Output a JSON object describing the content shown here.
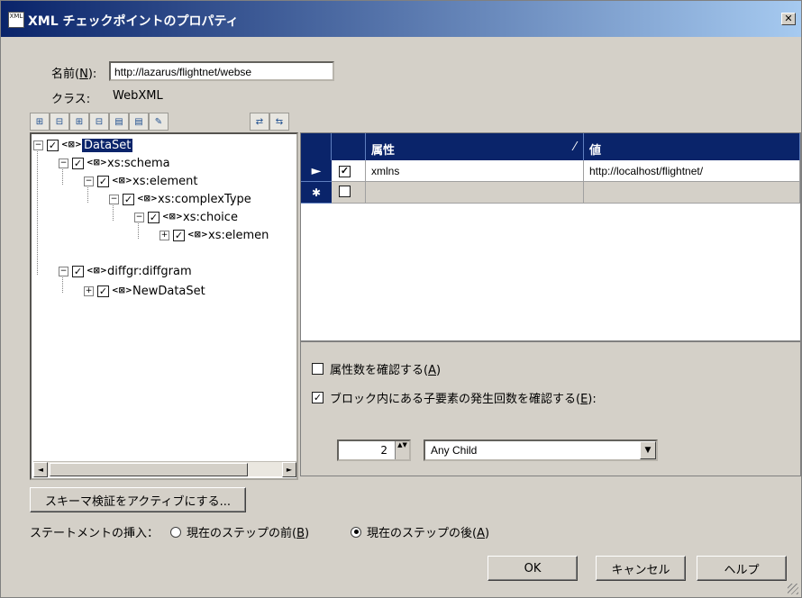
{
  "window": {
    "icon_label": "XML",
    "title": "XML チェックポイントのプロパティ",
    "close_glyph": "✕"
  },
  "name_field": {
    "label_prefix": "名前(",
    "label_hotkey": "N",
    "label_suffix": "):",
    "value": "http://lazarus/flightnet/webse"
  },
  "class_field": {
    "label": "クラス:",
    "value": "WebXML"
  },
  "toolbar": {
    "buttons": [
      {
        "icon": "add-child-icon"
      },
      {
        "icon": "add-sibling-icon"
      },
      {
        "icon": "add-attribute-icon"
      },
      {
        "icon": "remove-icon"
      },
      {
        "icon": "xml-import-icon"
      },
      {
        "icon": "xml-export-icon"
      },
      {
        "icon": "edit-icon"
      },
      {
        "icon": "check-all-icon"
      },
      {
        "icon": "uncheck-all-icon"
      }
    ]
  },
  "tree": {
    "nodes": [
      {
        "label": "DataSet",
        "expander": "−",
        "checked": "✓",
        "selected": true
      },
      {
        "label": "xs:schema",
        "expander": "−",
        "checked": "✓"
      },
      {
        "label": "xs:element",
        "expander": "−",
        "checked": "✓"
      },
      {
        "label": "xs:complexType",
        "expander": "−",
        "checked": "✓"
      },
      {
        "label": "xs:choice",
        "expander": "−",
        "checked": "✓"
      },
      {
        "label": "xs:elemen",
        "expander": "+",
        "checked": "✓"
      },
      {
        "label": "diffgr:diffgram",
        "expander": "−",
        "checked": "✓"
      },
      {
        "label": "NewDataSet",
        "expander": "+",
        "checked": "✓"
      }
    ],
    "xml_glyph": "<⊠>"
  },
  "grid": {
    "headers": {
      "attribute": "属性",
      "value": "値",
      "sort_glyph": "⁄"
    },
    "rows": [
      {
        "indicator": "►",
        "checked": "✓",
        "attribute": "xmlns",
        "value": "http://localhost/flightnet/"
      },
      {
        "indicator": "✱",
        "checked": "",
        "attribute": "",
        "value": ""
      }
    ]
  },
  "options": {
    "check_attr_count": {
      "label_prefix": "属性数を確認する(",
      "hotkey": "A",
      "label_suffix": ")",
      "checked": ""
    },
    "check_child_occurrence": {
      "label_prefix": "ブロック内にある子要素の発生回数を確認する(",
      "hotkey": "E",
      "label_suffix": "):",
      "checked": "✓"
    },
    "spin_value": "2",
    "spin_glyph": "▲▼",
    "combo_value": "Any Child",
    "combo_arrow": "▼"
  },
  "buttons": {
    "schema_validation": "スキーマ検証をアクティブにする...",
    "ok": "OK",
    "cancel": "キャンセル",
    "help": "ヘルプ"
  },
  "insert_statement": {
    "label": "ステートメントの挿入：",
    "before": {
      "prefix": "現在のステップの前(",
      "hotkey": "B",
      "suffix": ")",
      "selected": false
    },
    "after": {
      "prefix": "現在のステップの後(",
      "hotkey": "A",
      "suffix": ")",
      "selected": true
    }
  },
  "scrollbar": {
    "left": "◄",
    "right": "►"
  }
}
